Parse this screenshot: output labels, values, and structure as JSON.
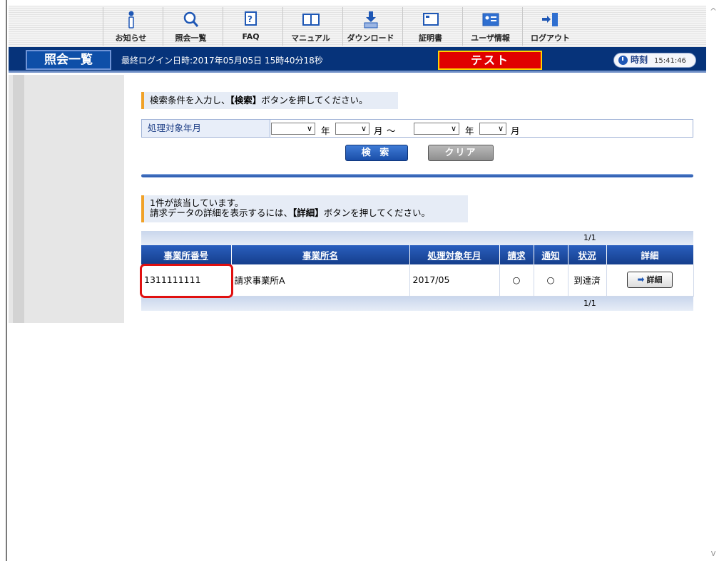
{
  "toolbar": {
    "items": [
      {
        "label": "お知らせ",
        "icon": "info-icon"
      },
      {
        "label": "照会一覧",
        "icon": "search-icon"
      },
      {
        "label": "FAQ",
        "icon": "faq-icon"
      },
      {
        "label": "マニュアル",
        "icon": "manual-book-icon"
      },
      {
        "label": "ダウンロード",
        "icon": "download-icon"
      },
      {
        "label": "証明書",
        "icon": "certificate-icon"
      },
      {
        "label": "ユーザ情報",
        "icon": "user-info-icon"
      },
      {
        "label": "ログアウト",
        "icon": "logout-icon"
      }
    ]
  },
  "titlebar": {
    "page_title": "照会一覧",
    "last_login": "最終ログイン日時:2017年05月05日 15時40分18秒",
    "env_badge": "テスト",
    "clock_label": "時刻",
    "clock_time": "15:41:46"
  },
  "search": {
    "instruction_pre": "検索条件を入力し、",
    "instruction_bold": "【検索】",
    "instruction_post": "ボタンを押してください。",
    "field_label": "処理対象年月",
    "unit_year": "年",
    "unit_month": "月",
    "range_sep": "〜",
    "search_button": "検 索",
    "clear_button": "クリア"
  },
  "results": {
    "count_text": "1件が該当しています。",
    "hint_pre": "請求データの詳細を表示するには、",
    "hint_bold": "【詳細】",
    "hint_post": "ボタンを押してください。",
    "page_indicator": "1/1",
    "columns": [
      "事業所番号",
      "事業所名",
      "処理対象年月",
      "請求",
      "通知",
      "状況",
      "詳細"
    ],
    "rows": [
      {
        "office_no": "1311111111",
        "office_name": "請求事業所A",
        "period": "2017/05",
        "claim": "○",
        "notice": "○",
        "status": "到達済",
        "detail": "詳細"
      }
    ]
  },
  "colors": {
    "titlebar_bg": "#06337a",
    "table_header": "#1f4fa6",
    "accent_orange": "#f0a22a",
    "test_red": "#e00000",
    "highlight_red": "#e01010"
  }
}
